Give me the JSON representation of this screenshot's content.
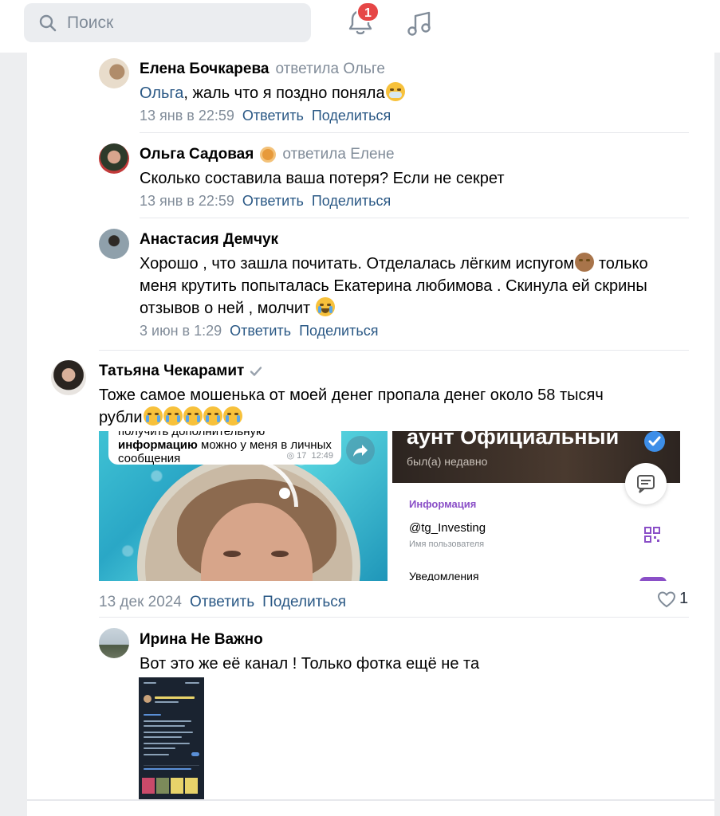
{
  "topbar": {
    "search_placeholder": "Поиск",
    "notification_count": "1"
  },
  "comments": [
    {
      "author": "Елена Бочкарева",
      "reply_to": "ответила Ольге",
      "mention": "Ольга",
      "text": ", жаль что я поздно поняла",
      "date": "13 янв в 22:59",
      "reply_label": "Ответить",
      "share_label": "Поделиться"
    },
    {
      "author": "Ольга Садовая",
      "reply_to": "ответила Елене",
      "text": "Сколько составила ваша потеря? Если не секрет",
      "date": "13 янв в 22:59",
      "reply_label": "Ответить",
      "share_label": "Поделиться"
    },
    {
      "author": "Анастасия Демчук",
      "text_line1": "Хорошо , что зашла почитать. Отделалась лёгким испугом",
      "text_line1_end": " только",
      "text_line2": "меня крутить попыталась Екатерина любимова . Скинула ей скрины",
      "text_line3": "отзывов о ней , молчит ",
      "date": "3 июн в 1:29",
      "reply_label": "Ответить",
      "share_label": "Поделиться"
    },
    {
      "author": "Татьяна Чекарамит",
      "text_line1": "Тоже самое мошенька от моей денег пропала денег около 58 тысяч",
      "text_line2": "рубли",
      "date": "13 дек 2024",
      "reply_label": "Ответить",
      "share_label": "Поделиться",
      "likes": "1",
      "attachment": {
        "bubble_line1": "получить дополнительную",
        "bubble_bold": "информацию",
        "bubble_line2": " можно у меня в личных",
        "bubble_line3": "сообщения",
        "bubble_views": "◎ 17",
        "bubble_time": "12:49",
        "profile_title": "аунт   Официальный",
        "profile_status": "был(а) недавно",
        "info_label": "Информация",
        "username": "@tg_Investing",
        "username_label": "Имя пользователя",
        "notifications_label": "Уведомления"
      }
    },
    {
      "author": "Ирина Не Важно",
      "text": "Вот это же её канал ! Только фотка ещё не та"
    }
  ],
  "icons": [
    "search-icon",
    "bell-icon",
    "music-icon",
    "verified-icon",
    "heart-icon",
    "share-icon",
    "chat-icon",
    "qr-icon"
  ],
  "colors": {
    "link": "#2a5885",
    "secondary": "#818c99",
    "badge": "#e64646",
    "accent_purple": "#8a4fc7"
  }
}
